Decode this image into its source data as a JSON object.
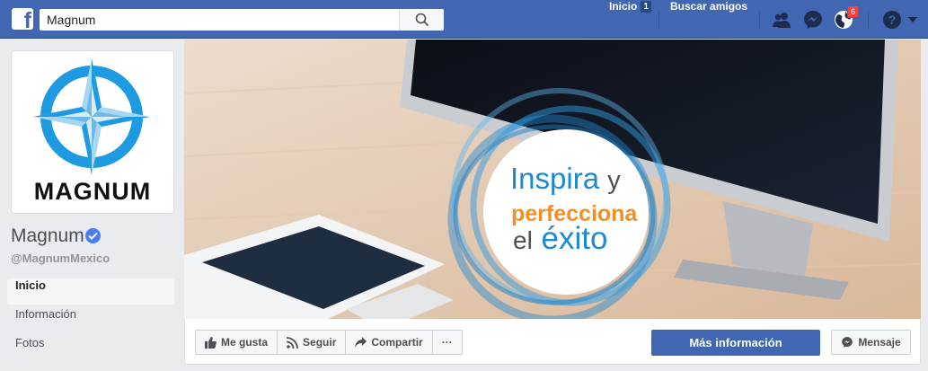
{
  "search": {
    "value": "Magnum"
  },
  "nav": {
    "home_label": "Inicio",
    "home_count": "1",
    "find_friends_label": "Buscar amigos",
    "notifications_count": "6"
  },
  "profile": {
    "logo_text": "MAGNUM",
    "name": "Magnum",
    "handle": "@MagnumMexico"
  },
  "sidebar": {
    "items": [
      {
        "label": "Inicio"
      },
      {
        "label": "Información"
      },
      {
        "label": "Fotos"
      }
    ]
  },
  "cover": {
    "line1_word": "Inspira",
    "line1_tail": "y",
    "line2": "perfecciona",
    "line3_word": "el",
    "line3_tail": "éxito"
  },
  "actions": {
    "like_label": "Me gusta",
    "follow_label": "Seguir",
    "share_label": "Compartir",
    "more_label": "···",
    "primary_label": "Más información",
    "message_label": "Mensaje"
  },
  "colors": {
    "brand": "#4267b2",
    "logo_blue": "#1e9be0",
    "cover_orange": "#f0902a",
    "badge_red": "#fa3e3e"
  },
  "icons": [
    "facebook-logo",
    "search-icon",
    "friends-icon",
    "messenger-icon",
    "globe-icon",
    "help-icon",
    "dropdown-icon",
    "verified-icon",
    "thumb-up-icon",
    "rss-icon",
    "share-arrow-icon",
    "messenger-icon"
  ]
}
